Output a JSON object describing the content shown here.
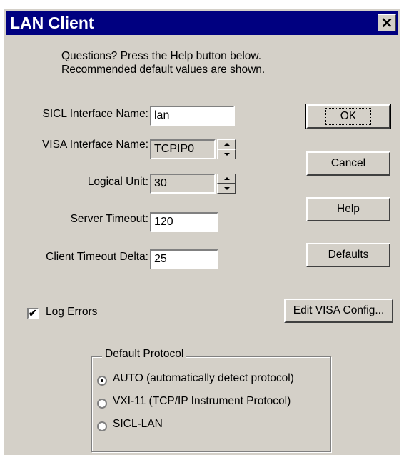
{
  "window": {
    "title": "LAN Client",
    "close_glyph": "✕"
  },
  "intro": {
    "line1": "Questions?  Press the Help button below.",
    "line2": "Recommended default values are shown."
  },
  "fields": {
    "sicl_interface_name": {
      "label": "SICL Interface Name:",
      "value": "lan"
    },
    "visa_interface_name": {
      "label": "VISA Interface Name:",
      "value": "TCPIP0"
    },
    "logical_unit": {
      "label": "Logical Unit:",
      "value": "30"
    },
    "server_timeout": {
      "label": "Server Timeout:",
      "value": "120"
    },
    "client_timeout_delta": {
      "label": "Client Timeout Delta:",
      "value": "25"
    }
  },
  "buttons": {
    "ok": "OK",
    "cancel": "Cancel",
    "help": "Help",
    "defaults": "Defaults",
    "edit_visa_config": "Edit VISA Config..."
  },
  "log_errors": {
    "label": "Log Errors",
    "checked": true,
    "check_glyph": "✔"
  },
  "default_protocol": {
    "legend": "Default Protocol",
    "options": [
      {
        "label": "AUTO (automatically detect protocol)",
        "selected": true
      },
      {
        "label": "VXI-11 (TCP/IP Instrument Protocol)",
        "selected": false
      },
      {
        "label": "SICL-LAN",
        "selected": false
      }
    ]
  },
  "colors": {
    "titlebar": "#000080",
    "dialog_face": "#d4d0c8"
  }
}
